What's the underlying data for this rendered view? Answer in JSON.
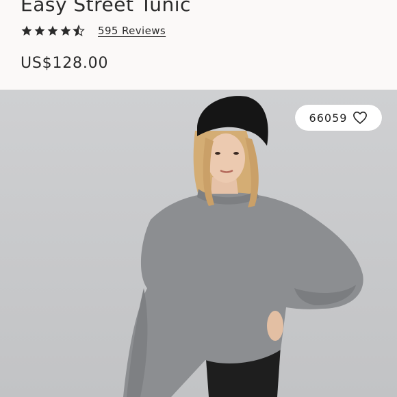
{
  "product": {
    "title": "Easy Street Tunic",
    "rating": 4.5,
    "max_rating": 5,
    "reviews_label": "595 Reviews",
    "price": "US$128.00"
  },
  "photo": {
    "likes_count": "66059",
    "like_icon": "heart-outline-icon",
    "colors": {
      "background": "#c8c9cb",
      "sweater": "#8b8d90",
      "beanie": "#161616",
      "hair": "#d8b27a"
    }
  }
}
